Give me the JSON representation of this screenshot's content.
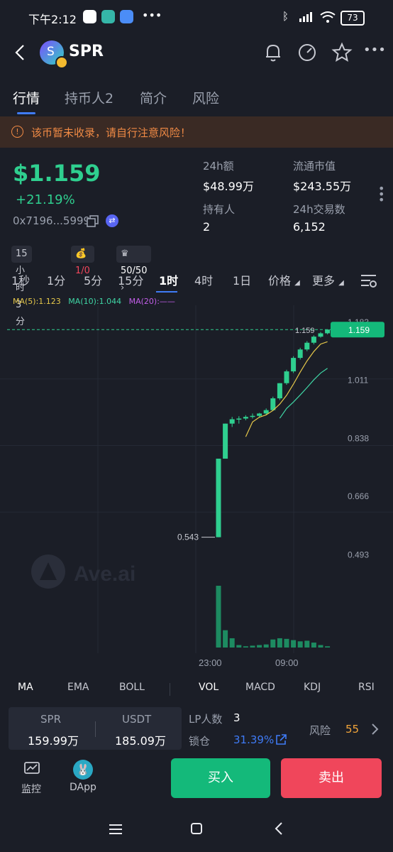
{
  "status": {
    "time": "下午2:12",
    "battery": "73"
  },
  "header": {
    "symbol": "SPR",
    "logo_letter": "S"
  },
  "tabs": [
    "行情",
    "持币人2",
    "简介",
    "风险"
  ],
  "warning": "该币暂未收录，请自行注意风险！",
  "token": {
    "price": "$1.159",
    "change": "+21.19%",
    "address": "0x7196...5999",
    "stats": [
      {
        "label": "24h额",
        "value": "$48.99万"
      },
      {
        "label": "流通市值",
        "value": "$243.55万"
      },
      {
        "label": "持有人",
        "value": "2"
      },
      {
        "label": "24h交易数",
        "value": "6,152"
      }
    ]
  },
  "badges": {
    "age": "15小时 3分",
    "tax": "1/0",
    "score": "50/50"
  },
  "intervals": [
    "1秒",
    "1分",
    "5分",
    "15分",
    "1时",
    "4时",
    "1日"
  ],
  "active_interval": "1时",
  "chart_controls": {
    "price": "价格",
    "more": "更多"
  },
  "ma_legend": {
    "ma5": "MA(5):1.123",
    "ma10": "MA(10):1.044",
    "ma20": "MA(20):——"
  },
  "colors": {
    "up": "#2fcf8f",
    "down": "#f0465b",
    "ma5": "#e6c84a",
    "ma10": "#3fd6a5",
    "ma20": "#c25ee8"
  },
  "chart_data": {
    "type": "candlestick",
    "y_ticks": [
      "1.183",
      "1.011",
      "0.838",
      "0.666",
      "0.493"
    ],
    "ylim": [
      0.42,
      1.21
    ],
    "x_ticks": [
      "23:00",
      "09:00"
    ],
    "current_price_label": "1.159",
    "low_label": "0.543",
    "high_label": "1.159",
    "watermark": "Ave.ai",
    "candles": [
      {
        "o": 0.543,
        "h": 0.776,
        "l": 0.543,
        "c": 0.776
      },
      {
        "o": 0.776,
        "h": 0.88,
        "l": 0.776,
        "c": 0.88
      },
      {
        "o": 0.88,
        "h": 0.9,
        "l": 0.87,
        "c": 0.893
      },
      {
        "o": 0.893,
        "h": 0.902,
        "l": 0.88,
        "c": 0.895
      },
      {
        "o": 0.895,
        "h": 0.905,
        "l": 0.89,
        "c": 0.9
      },
      {
        "o": 0.9,
        "h": 0.91,
        "l": 0.895,
        "c": 0.903
      },
      {
        "o": 0.903,
        "h": 0.912,
        "l": 0.898,
        "c": 0.91
      },
      {
        "o": 0.91,
        "h": 0.925,
        "l": 0.905,
        "c": 0.92
      },
      {
        "o": 0.92,
        "h": 0.96,
        "l": 0.918,
        "c": 0.955
      },
      {
        "o": 0.955,
        "h": 1.0,
        "l": 0.95,
        "c": 1.0
      },
      {
        "o": 1.0,
        "h": 1.04,
        "l": 0.995,
        "c": 1.035
      },
      {
        "o": 1.035,
        "h": 1.08,
        "l": 1.03,
        "c": 1.075
      },
      {
        "o": 1.075,
        "h": 1.105,
        "l": 1.07,
        "c": 1.1
      },
      {
        "o": 1.1,
        "h": 1.125,
        "l": 1.095,
        "c": 1.12
      },
      {
        "o": 1.12,
        "h": 1.142,
        "l": 1.115,
        "c": 1.138
      },
      {
        "o": 1.138,
        "h": 1.152,
        "l": 1.135,
        "c": 1.148
      },
      {
        "o": 1.148,
        "h": 1.16,
        "l": 1.145,
        "c": 1.159
      }
    ],
    "volume": [
      1.0,
      0.28,
      0.15,
      0.04,
      0.02,
      0.03,
      0.04,
      0.05,
      0.13,
      0.15,
      0.14,
      0.12,
      0.1,
      0.11,
      0.08,
      0.04,
      0.02
    ],
    "ma5": [
      null,
      null,
      null,
      null,
      0.841,
      0.885,
      0.899,
      0.906,
      0.919,
      0.938,
      0.964,
      0.997,
      1.033,
      1.066,
      1.094,
      1.116,
      1.123
    ],
    "ma10": [
      null,
      null,
      null,
      null,
      null,
      null,
      null,
      null,
      null,
      0.896,
      0.925,
      0.944,
      0.965,
      0.987,
      1.01,
      1.03,
      1.044
    ]
  },
  "indicators": [
    "MA",
    "EMA",
    "BOLL",
    "VOL",
    "MACD",
    "KDJ",
    "RSI"
  ],
  "pool": {
    "base": "SPR",
    "quote": "USDT",
    "base_amount": "159.99万",
    "quote_amount": "185.09万"
  },
  "lp": {
    "lp_label": "LP人数",
    "lp_count": "3",
    "lock_label": "锁仓",
    "lock_pct": "31.39%",
    "risk_label": "风险",
    "risk_score": "55"
  },
  "bottom_nav": {
    "monitor": "监控",
    "dapp": "DApp"
  },
  "actions": {
    "buy": "买入",
    "sell": "卖出"
  }
}
